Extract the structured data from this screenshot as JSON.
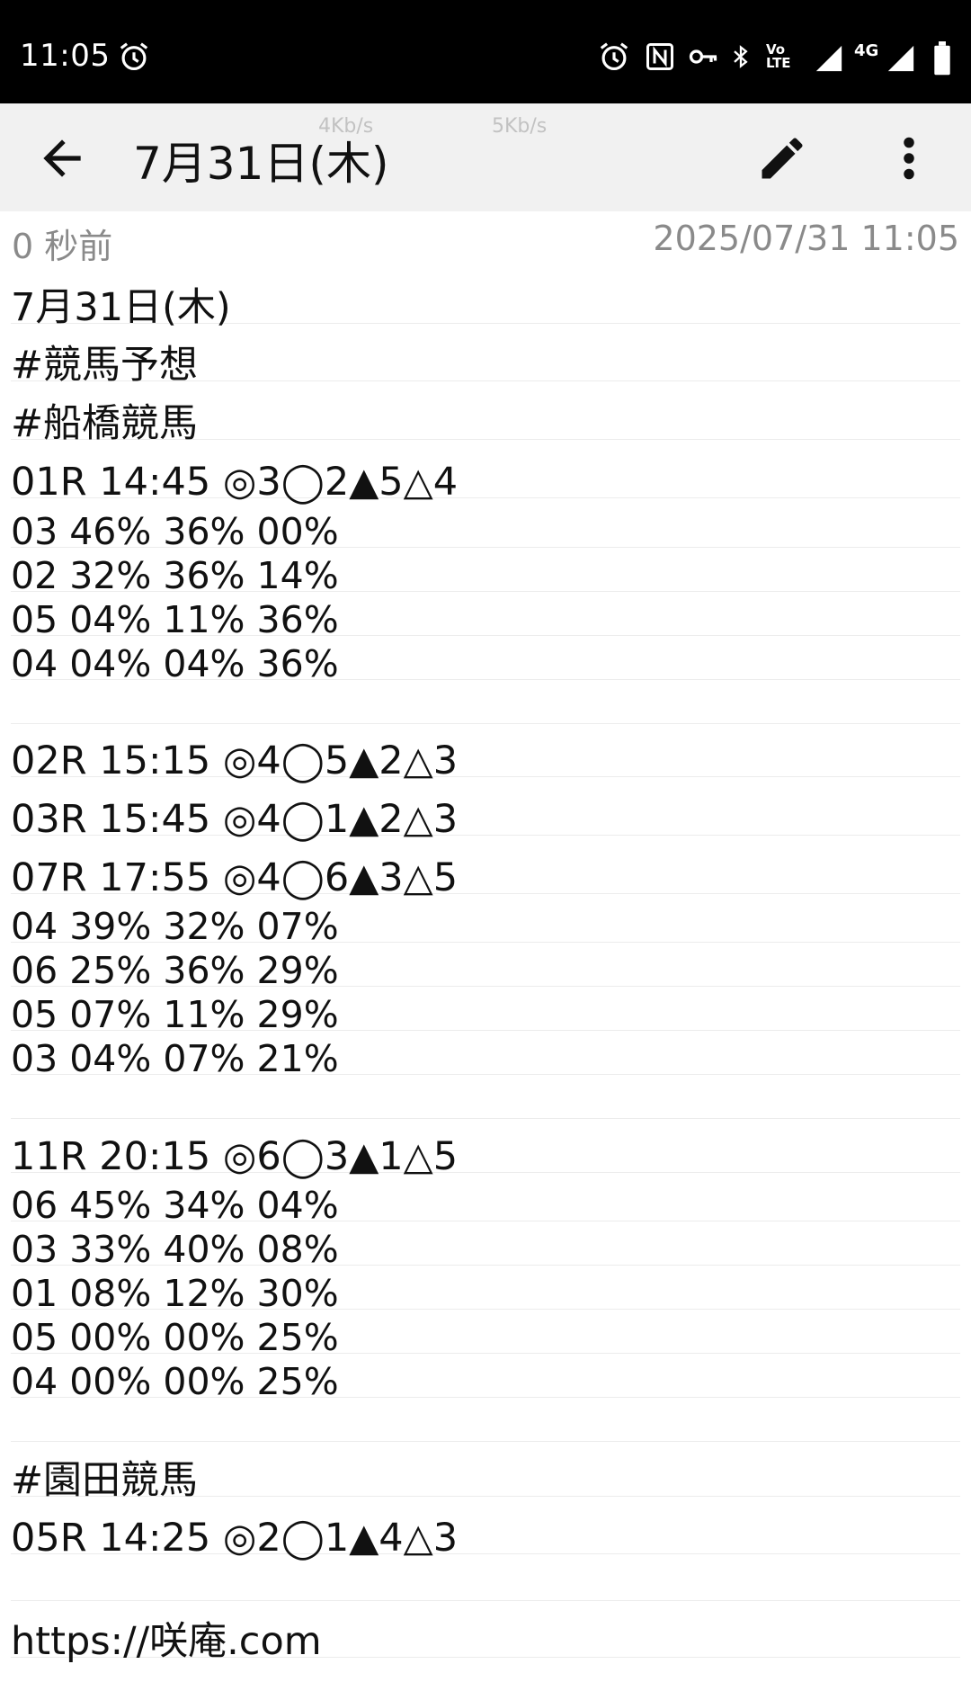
{
  "status_bar": {
    "time": "11:05",
    "icons": [
      "alarm-icon",
      "alarm-icon",
      "nfc-icon",
      "vpn-key-icon",
      "bluetooth-icon",
      "volte-icon",
      "signal-icon",
      "4g-signal-icon",
      "battery-icon"
    ],
    "network_label": "4G",
    "volte_label": "Vo LTE"
  },
  "app_bar": {
    "title": "7月31日(木)",
    "net_speed_1": "4Kb/s",
    "net_speed_2": "5Kb/s"
  },
  "meta": {
    "relative_time": "0 秒前",
    "timestamp": "2025/07/31 11:05"
  },
  "note_lines": [
    "7月31日(木)",
    "#競馬予想",
    "#船橋競馬",
    "01R 14:45 ◎3◯2▲5△4",
    "03 46% 36% 00%",
    "02 32% 36% 14%",
    "05 04% 11% 36%",
    "04 04% 04% 36%",
    "",
    "02R 15:15 ◎4◯5▲2△3",
    "03R 15:45 ◎4◯1▲2△3",
    "07R 17:55 ◎4◯6▲3△5",
    "04 39% 32% 07%",
    "06 25% 36% 29%",
    "05 07% 11% 29%",
    "03 04% 07% 21%",
    "",
    "11R 20:15 ◎6◯3▲1△5",
    "06 45% 34% 04%",
    "03 33% 40% 08%",
    "01 08% 12% 30%",
    "05 00% 00% 25%",
    "04 00% 00% 25%",
    "",
    "#園田競馬",
    "05R 14:25 ◎2◯1▲4△3",
    "",
    "https://咲庵.com"
  ]
}
